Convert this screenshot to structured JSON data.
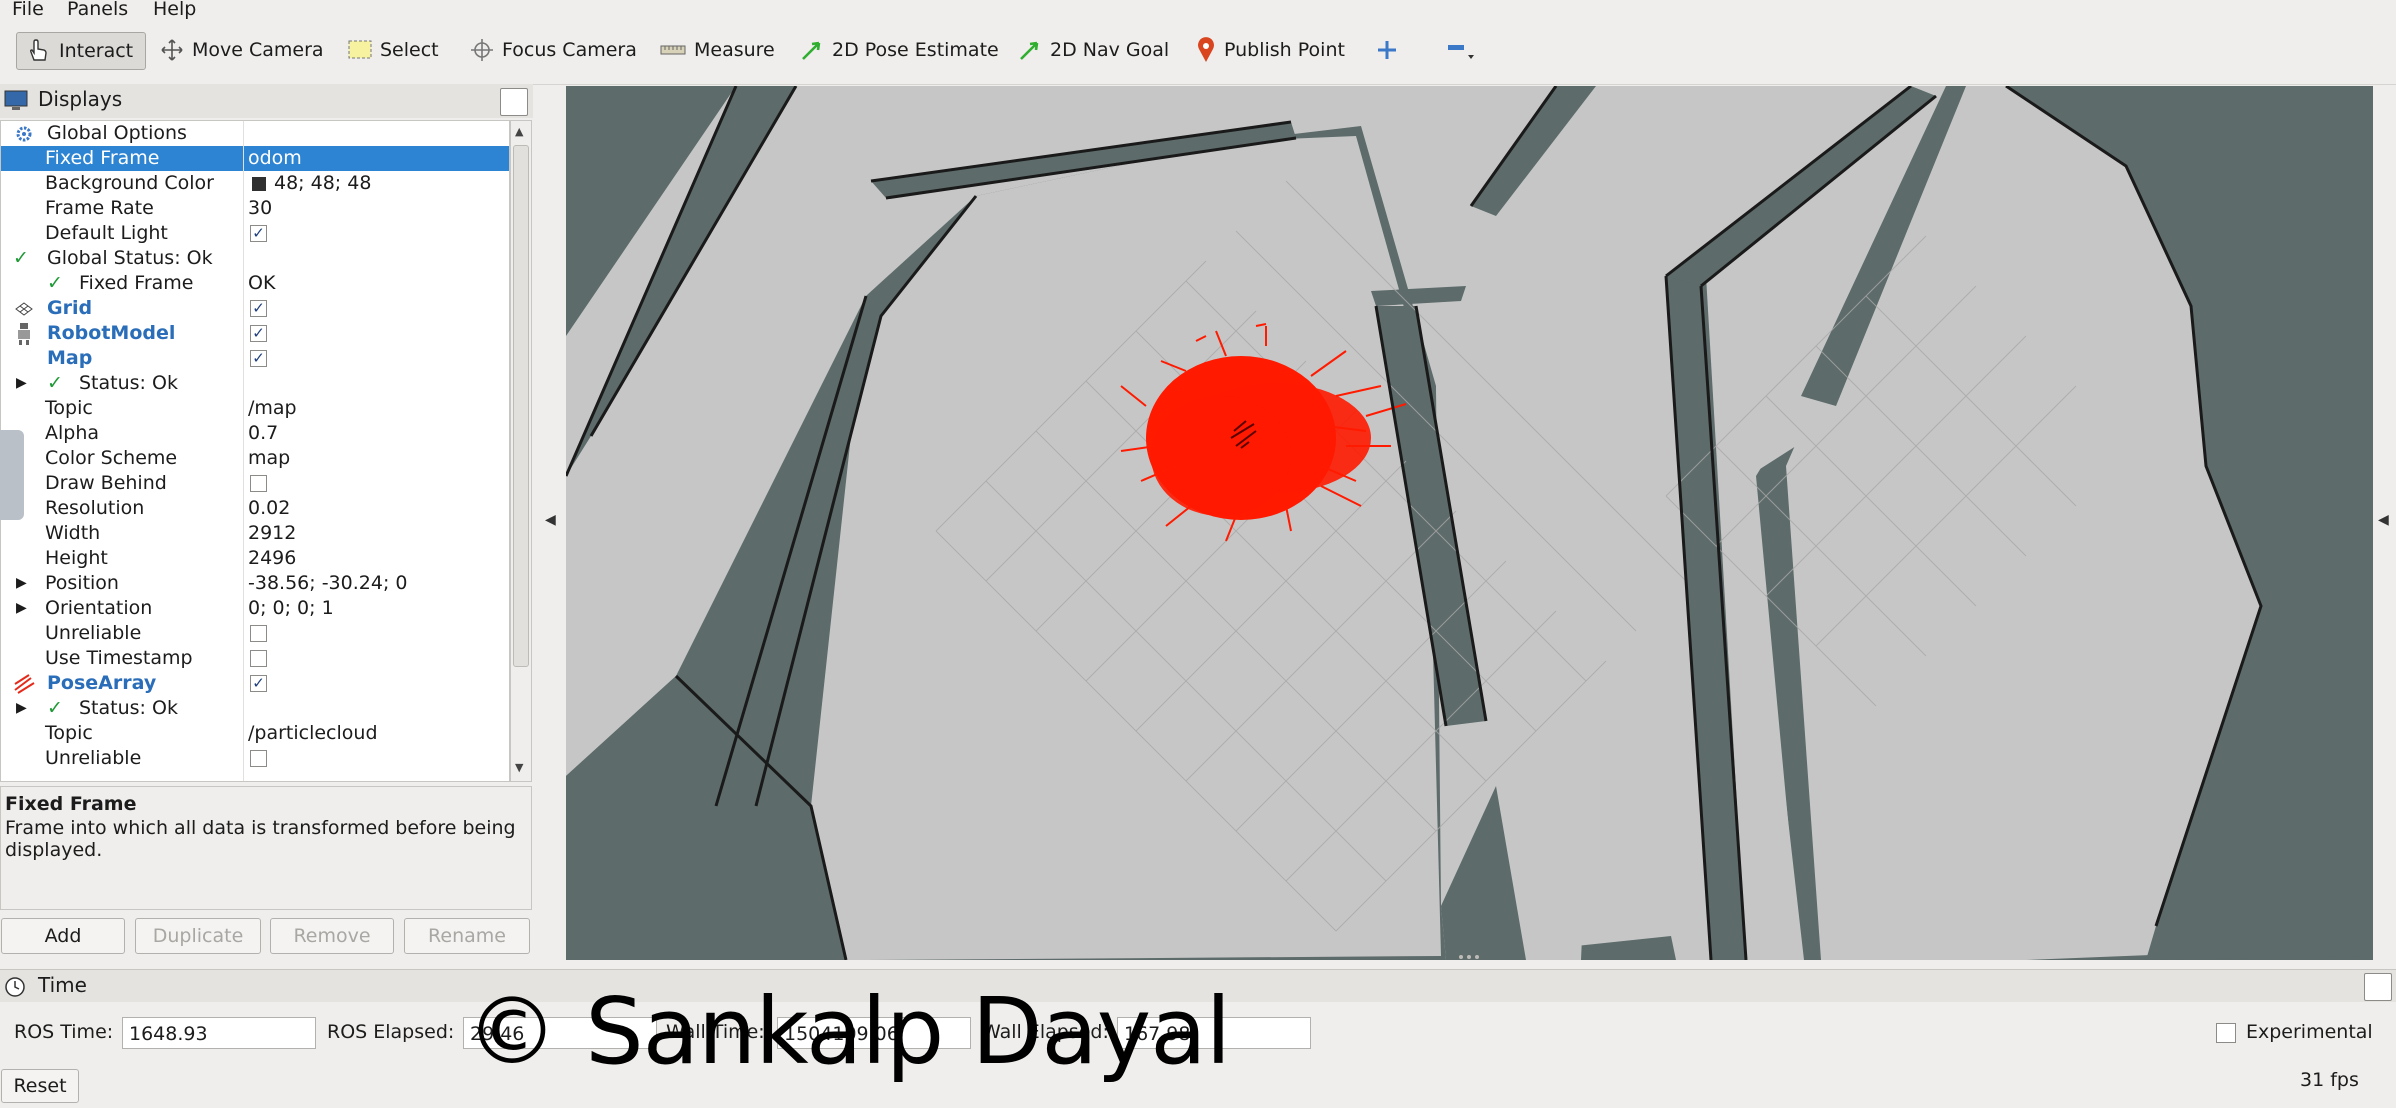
{
  "menu": {
    "file": "File",
    "panels": "Panels",
    "help": "Help"
  },
  "toolbar": {
    "interact": "Interact",
    "move_camera": "Move Camera",
    "select": "Select",
    "focus_camera": "Focus Camera",
    "measure": "Measure",
    "pose_estimate": "2D Pose Estimate",
    "nav_goal": "2D Nav Goal",
    "publish_point": "Publish Point"
  },
  "displays": {
    "title": "Displays",
    "rows": [
      {
        "name": "Global Options",
        "value": ""
      },
      {
        "name": "Fixed Frame",
        "value": "odom"
      },
      {
        "name": "Background Color",
        "value": "48; 48; 48"
      },
      {
        "name": "Frame Rate",
        "value": "30"
      },
      {
        "name": "Default Light",
        "value": ""
      },
      {
        "name": "Global Status: Ok",
        "value": ""
      },
      {
        "name": "Fixed Frame",
        "value": "OK"
      },
      {
        "name": "Grid",
        "value": ""
      },
      {
        "name": "RobotModel",
        "value": ""
      },
      {
        "name": "Map",
        "value": ""
      },
      {
        "name": "Status: Ok",
        "value": ""
      },
      {
        "name": "Topic",
        "value": "/map"
      },
      {
        "name": "Alpha",
        "value": "0.7"
      },
      {
        "name": "Color Scheme",
        "value": "map"
      },
      {
        "name": "Draw Behind",
        "value": ""
      },
      {
        "name": "Resolution",
        "value": "0.02"
      },
      {
        "name": "Width",
        "value": "2912"
      },
      {
        "name": "Height",
        "value": "2496"
      },
      {
        "name": "Position",
        "value": "-38.56; -30.24; 0"
      },
      {
        "name": "Orientation",
        "value": "0; 0; 0; 1"
      },
      {
        "name": "Unreliable",
        "value": ""
      },
      {
        "name": "Use Timestamp",
        "value": ""
      },
      {
        "name": "PoseArray",
        "value": ""
      },
      {
        "name": "Status: Ok",
        "value": ""
      },
      {
        "name": "Topic",
        "value": "/particlecloud"
      },
      {
        "name": "Unreliable",
        "value": ""
      }
    ],
    "desc_title": "Fixed Frame",
    "desc_text": "Frame into which all data is transformed before being displayed.",
    "buttons": {
      "add": "Add",
      "duplicate": "Duplicate",
      "remove": "Remove",
      "rename": "Rename"
    }
  },
  "time": {
    "title": "Time",
    "ros_time_label": "ROS Time:",
    "ros_time": "1648.93",
    "ros_elapsed_label": "ROS Elapsed:",
    "ros_elapsed": "29.46",
    "wall_time_label": "Wall Time:",
    "wall_time": "1504109.06",
    "wall_elapsed_label": "Wall Elapsed:",
    "wall_elapsed": "167.98",
    "experimental": "Experimental",
    "reset": "Reset",
    "fps": "31 fps"
  },
  "watermark": "© Sankalp Dayal",
  "colors": {
    "selection": "#2d84d2",
    "map_free": "#c6c6c6",
    "map_wall": "#5d6b6a",
    "particles": "#ff1a00"
  }
}
